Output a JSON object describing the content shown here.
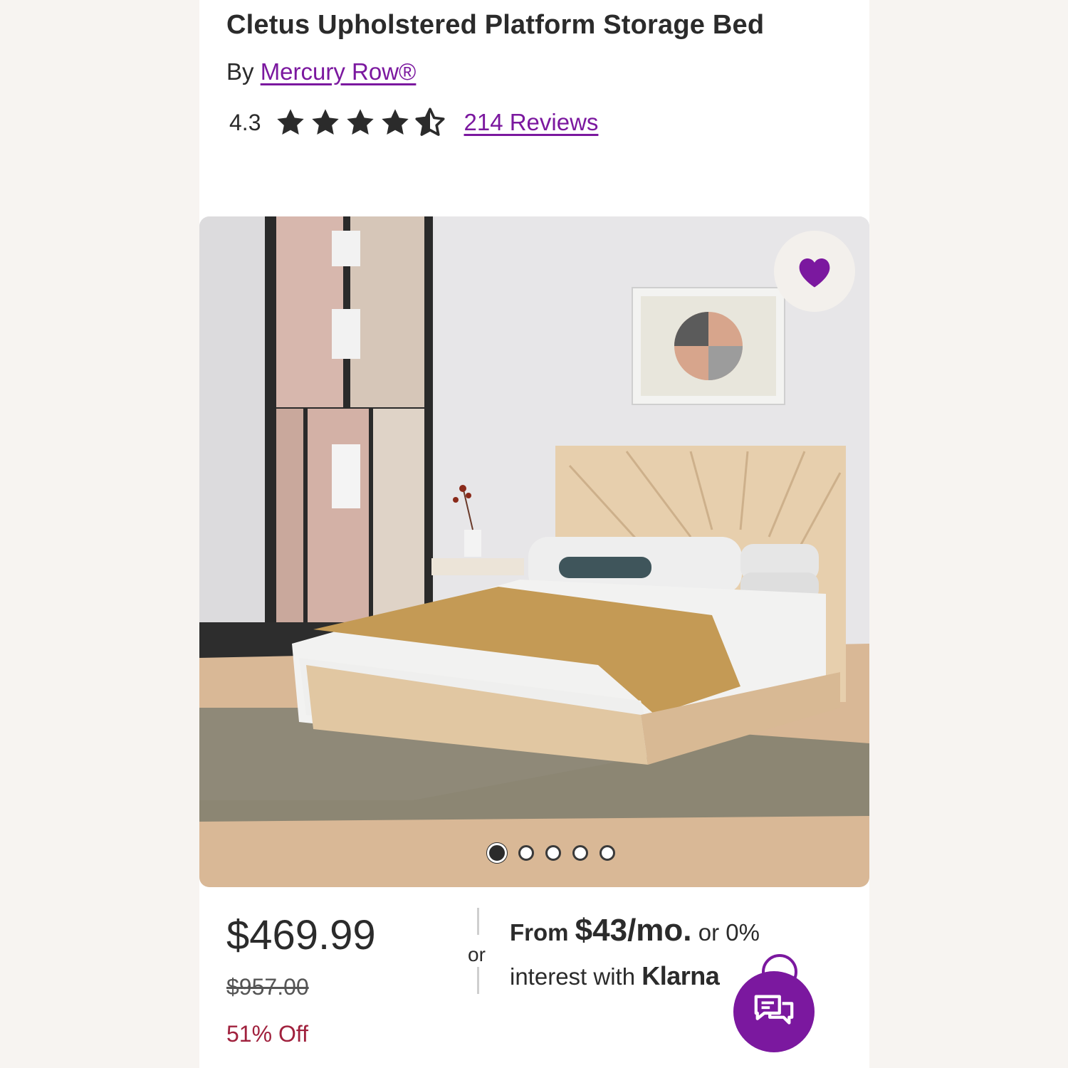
{
  "product": {
    "title": "Cletus Upholstered Platform Storage Bed",
    "by_prefix": "By",
    "brand": "Mercury Row®",
    "rating": "4.3",
    "rating_value": 4.3,
    "rating_max": 5,
    "reviews_label": "214 Reviews"
  },
  "gallery": {
    "image_count": 5,
    "active_index": 0,
    "favorite_icon": "heart-icon",
    "favorited": true
  },
  "pricing": {
    "price": "$469.99",
    "original_price": "$957.00",
    "discount": "51% Off",
    "or_label": "or",
    "finance_from": "From",
    "finance_amount": "$43/mo.",
    "finance_rest": "or 0%",
    "finance_line2": "interest with",
    "finance_brand": "Klarna"
  },
  "colors": {
    "accent": "#7b189f",
    "discount": "#a0213d",
    "text": "#2b2b2b"
  },
  "chat": {
    "icon": "chat-icon"
  }
}
